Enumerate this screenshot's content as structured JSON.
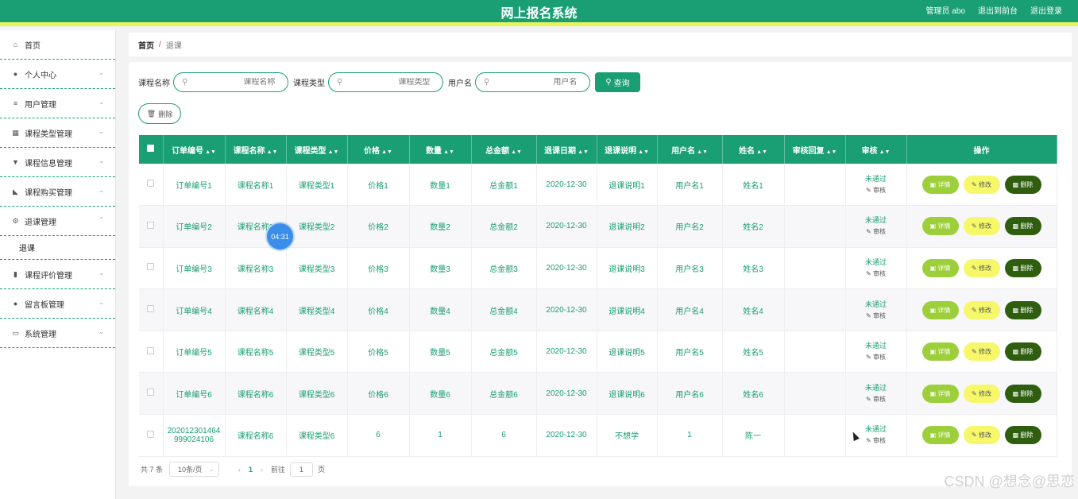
{
  "header": {
    "title": "网上报名系统",
    "admin": "管理员 abo",
    "front": "退出到前台",
    "logout": "退出登录"
  },
  "sidebar": {
    "items": [
      {
        "label": "首页",
        "icon": "⌂"
      },
      {
        "label": "个人中心",
        "icon": "●"
      },
      {
        "label": "用户管理",
        "icon": "≡"
      },
      {
        "label": "课程类型管理",
        "icon": "▦"
      },
      {
        "label": "课程信息管理",
        "icon": "▼"
      },
      {
        "label": "课程购买管理",
        "icon": "◣"
      },
      {
        "label": "退课管理",
        "icon": "⚙"
      },
      {
        "label": "课程评价管理",
        "icon": "▮"
      },
      {
        "label": "留言板管理",
        "icon": "●"
      },
      {
        "label": "系统管理",
        "icon": "▭"
      }
    ],
    "submenu_label": "退课"
  },
  "breadcrumb": {
    "home": "首页",
    "sep": "/",
    "current": "退课"
  },
  "search": {
    "course_name_label": "课程名称",
    "course_name_placeholder": "课程名称",
    "course_type_label": "课程类型",
    "course_type_placeholder": "课程类型",
    "username_label": "用户名",
    "username_placeholder": "用户名",
    "query_label": "查询",
    "delete_label": "删除"
  },
  "table": {
    "headers": [
      "订单编号",
      "课程名称",
      "课程类型",
      "价格",
      "数量",
      "总金额",
      "退课日期",
      "退课说明",
      "用户名",
      "姓名",
      "审核回复",
      "审核",
      "操作"
    ],
    "rows": [
      [
        "订单编号1",
        "课程名称1",
        "课程类型1",
        "价格1",
        "数量1",
        "总金额1",
        "2020-12-30",
        "退课说明1",
        "用户名1",
        "姓名1",
        ""
      ],
      [
        "订单编号2",
        "课程名称2",
        "课程类型2",
        "价格2",
        "数量2",
        "总金额2",
        "2020-12-30",
        "退课说明2",
        "用户名2",
        "姓名2",
        ""
      ],
      [
        "订单编号3",
        "课程名称3",
        "课程类型3",
        "价格3",
        "数量3",
        "总金额3",
        "2020-12-30",
        "退课说明3",
        "用户名3",
        "姓名3",
        ""
      ],
      [
        "订单编号4",
        "课程名称4",
        "课程类型4",
        "价格4",
        "数量4",
        "总金额4",
        "2020-12-30",
        "退课说明4",
        "用户名4",
        "姓名4",
        ""
      ],
      [
        "订单编号5",
        "课程名称5",
        "课程类型5",
        "价格5",
        "数量5",
        "总金额5",
        "2020-12-30",
        "退课说明5",
        "用户名5",
        "姓名5",
        ""
      ],
      [
        "订单编号6",
        "课程名称6",
        "课程类型6",
        "价格6",
        "数量6",
        "总金额6",
        "2020-12-30",
        "退课说明6",
        "用户名6",
        "姓名6",
        ""
      ],
      [
        "202012301464\n999024106",
        "课程名称6",
        "课程类型6",
        "6",
        "1",
        "6",
        "2020-12-30",
        "不想学",
        "1",
        "陈一",
        ""
      ]
    ],
    "audit_status": "未通过",
    "audit_link": "审核",
    "op_detail": "详情",
    "op_edit": "修改",
    "op_delete": "删除"
  },
  "pager": {
    "total": "共 7 条",
    "page_size": "10条/页",
    "current_page": "1",
    "goto_label": "前往",
    "goto_value": "1",
    "page_unit": "页"
  },
  "overlay": {
    "timer": "04:31",
    "watermark": "CSDN @想念@思恋"
  },
  "colors": {
    "primary": "#1a9e74",
    "accent_bar": "#e8f55a",
    "detail": "#9ccf3a",
    "edit": "#f6f86a",
    "delete": "#2e5e0e"
  }
}
